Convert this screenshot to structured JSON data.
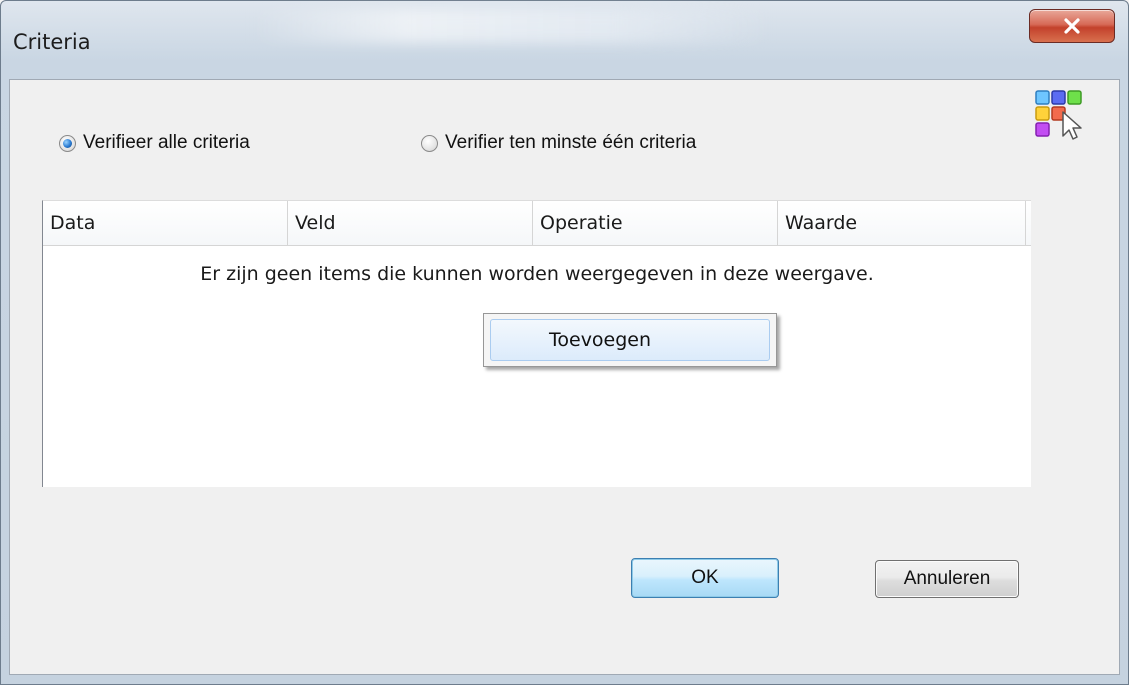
{
  "window": {
    "title": "Criteria",
    "close_label": "close"
  },
  "match_mode": {
    "options": [
      {
        "label": "Verifieer alle criteria",
        "checked": true
      },
      {
        "label": "Verifier ten minste één criteria",
        "checked": false
      }
    ]
  },
  "list": {
    "columns": [
      "Data",
      "Veld",
      "Operatie",
      "Waarde"
    ],
    "empty_text": "Er zijn geen items die kunnen worden weergegeven in deze weergave."
  },
  "context_menu": {
    "items": [
      "Toevoegen"
    ]
  },
  "buttons": {
    "ok": "OK",
    "cancel": "Annuleren"
  },
  "icons": {
    "close": "close-icon",
    "logo": "app-logo-grid-cursor-icon"
  },
  "colors": {
    "close_button": "#c3412c",
    "ok_border": "#3c7fb1",
    "selection": "#aaccf0"
  }
}
